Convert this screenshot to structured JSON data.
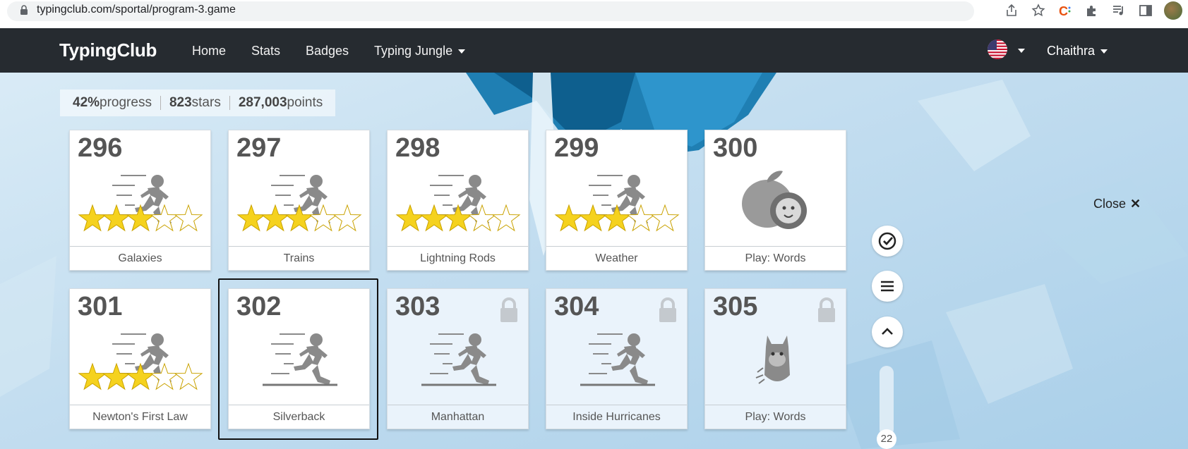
{
  "browser": {
    "url": "typingclub.com/sportal/program-3.game",
    "icons": [
      "share-icon",
      "star-icon",
      "extension-c-icon",
      "puzzle-icon",
      "media-icon",
      "sidepanel-icon",
      "profile-avatar"
    ]
  },
  "navbar": {
    "brand": "TypingClub",
    "links": [
      "Home",
      "Stats",
      "Badges"
    ],
    "dropdown": "Typing Jungle",
    "user": "Chaithra",
    "locale_icon": "us-flag-icon"
  },
  "progress": {
    "percent": "42%",
    "percent_label": " progress",
    "stars": "823",
    "stars_label": " stars",
    "points": "287,003",
    "points_label": " points"
  },
  "lessons": [
    {
      "number": "296",
      "name": "Galaxies",
      "art": "runner",
      "stars": 3,
      "locked": false
    },
    {
      "number": "297",
      "name": "Trains",
      "art": "runner",
      "stars": 3,
      "locked": false
    },
    {
      "number": "298",
      "name": "Lightning Rods",
      "art": "runner",
      "stars": 3,
      "locked": false
    },
    {
      "number": "299",
      "name": "Weather",
      "art": "runner",
      "stars": 3,
      "locked": false
    },
    {
      "number": "300",
      "name": "Play: Words",
      "art": "apple-game",
      "stars": 0,
      "locked": false
    },
    {
      "number": "301",
      "name": "Newton's First Law",
      "art": "runner",
      "stars": 3,
      "locked": false
    },
    {
      "number": "302",
      "name": "Silverback",
      "art": "runner",
      "stars": 0,
      "locked": false,
      "selected": true
    },
    {
      "number": "303",
      "name": "Manhattan",
      "art": "runner",
      "stars": 0,
      "locked": true
    },
    {
      "number": "304",
      "name": "Inside Hurricanes",
      "art": "runner",
      "stars": 0,
      "locked": true
    },
    {
      "number": "305",
      "name": "Play: Words",
      "art": "monster-game",
      "stars": 0,
      "locked": true
    }
  ],
  "side": {
    "close_label": "Close",
    "close_symbol": "✕",
    "scroll_count": "22"
  },
  "colors": {
    "navbar": "#262b30",
    "star": "#f5d21e",
    "background": "#c4def0"
  }
}
